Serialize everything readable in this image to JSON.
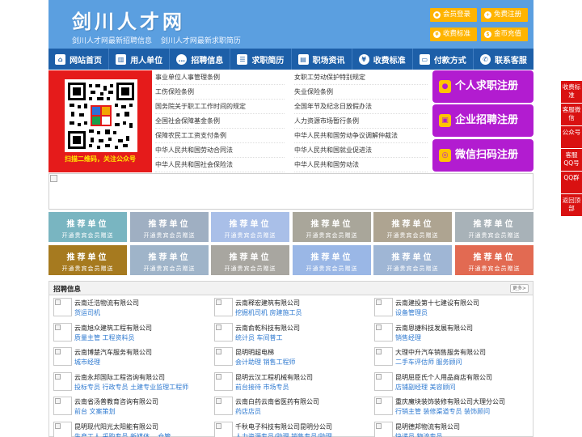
{
  "header": {
    "title": "剑川人才网",
    "subtitle": [
      "剑川人才网最新招聘信息",
      "剑川人才网最新求职简历"
    ],
    "buttons": [
      {
        "label": "会员登录",
        "icon": "user-icon"
      },
      {
        "label": "免费注册",
        "icon": "user-plus-icon"
      },
      {
        "label": "收费标准",
        "icon": "yen-icon"
      },
      {
        "label": "金币充值",
        "icon": "coin-icon"
      }
    ],
    "accent": "#ffb400",
    "bg": "#5b9fe0"
  },
  "nav": {
    "bg": "#1d5fa8",
    "items": [
      {
        "label": "网站首页",
        "icon": "home-icon",
        "glyph": "⌂"
      },
      {
        "label": "用人单位",
        "icon": "building-icon",
        "glyph": "▥"
      },
      {
        "label": "招聘信息",
        "icon": "chat-icon",
        "glyph": "✉"
      },
      {
        "label": "求职简历",
        "icon": "document-icon",
        "glyph": "☰"
      },
      {
        "label": "职场资讯",
        "icon": "news-icon",
        "glyph": "▤"
      },
      {
        "label": "收费标准",
        "icon": "yen-icon",
        "glyph": "¥"
      },
      {
        "label": "付款方式",
        "icon": "card-icon",
        "glyph": "▭"
      },
      {
        "label": "联系客服",
        "icon": "phone-icon",
        "glyph": "✆"
      }
    ]
  },
  "qr": {
    "caption": "扫描二维码，关注公众号"
  },
  "laws": {
    "left": [
      "事业单位人事管理条例",
      "工伤保险条例",
      "国务院关于职工工作时间的规定",
      "全国社会保障基金条例",
      "保障农民工工资支付条例",
      "中华人民共和国劳动合同法",
      "中华人民共和国社会保险法"
    ],
    "right": [
      "女职工劳动保护特别规定",
      "失业保险条例",
      "全国年节及纪念日放假办法",
      "人力资源市场暂行条例",
      "中华人民共和国劳动争议调解仲裁法",
      "中华人民共和国就业促进法",
      "中华人民共和国劳动法"
    ]
  },
  "register": [
    {
      "label": "个人求职注册",
      "icon": "person-icon"
    },
    {
      "label": "企业招聘注册",
      "icon": "company-icon"
    },
    {
      "label": "微信扫码注册",
      "icon": "wechat-icon"
    }
  ],
  "recommend": {
    "title": "推荐单位",
    "sub": "开通贵宾会员赠送",
    "colors": [
      [
        "#79b5c1",
        "#9fafc2",
        "#a9bfe8",
        "#a9a69a",
        "#aea491",
        "#a8b2b8"
      ],
      [
        "#a67a1f",
        "#9fb4c9",
        "#a8a6a0",
        "#9ab7e6",
        "#9fb6d5",
        "#e26a52"
      ]
    ]
  },
  "jobs": {
    "title": "招聘信息",
    "more": "更多>",
    "columns": [
      [
        {
          "company": "云南迁浩物流有限公司",
          "positions": "货运司机"
        },
        {
          "company": "云南旭众建筑工程有限公司",
          "positions": "质量主管 工程资料员"
        },
        {
          "company": "云南博楚汽车服务有限公司",
          "positions": "城市经理"
        },
        {
          "company": "云南永邦国际工程咨询有限公司",
          "positions": "投标专员 行政专员 土建专业监理工程师"
        },
        {
          "company": "云南省汤普教育咨询有限公司",
          "positions": "前台 文案策划"
        },
        {
          "company": "昆明现代阳光太阳能有限公司",
          "positions": "生产工人 采购专员 新媒体... 仓管"
        }
      ],
      [
        {
          "company": "云南释宏建筑有限公司",
          "positions": "挖掘机司机 房建施工员"
        },
        {
          "company": "云南俞乾科技有限公司",
          "positions": "统计员 车间普工"
        },
        {
          "company": "昆明明超电梯",
          "positions": "会计助理 销售工程师"
        },
        {
          "company": "昆明云汉工程机械有限公司",
          "positions": "前台接待 市场专员"
        },
        {
          "company": "云南白药云南省医药有限公司",
          "positions": "药店店员"
        },
        {
          "company": "千秋电子科技有限公司昆明分公司",
          "positions": "人力资源专员/助理 销售专员/助理"
        }
      ],
      [
        {
          "company": "云南建投第十七建设有限公司",
          "positions": "设备管理员"
        },
        {
          "company": "云南恩捷科技发展有限公司",
          "positions": "销售经理"
        },
        {
          "company": "大理中升汽车销售服务有限公司",
          "positions": "二手车评估师 服务顾问"
        },
        {
          "company": "昆明屈臣氏个人用品商店有限公司",
          "positions": "店铺副经理 美容顾问"
        },
        {
          "company": "重庆魔块装饰装修有限公司大理分公司",
          "positions": "行销主管 装修渠道专员 装饰顾问"
        },
        {
          "company": "昆明德邦物流有限公司",
          "positions": "快递员 物流专员"
        }
      ]
    ]
  },
  "side": [
    {
      "label": "收费标准"
    },
    {
      "label": "客服微信"
    },
    {
      "label": "公众号"
    },
    {
      "label": "客服QQ号"
    },
    {
      "label": "QQ群"
    },
    {
      "label": "返回顶部"
    }
  ]
}
